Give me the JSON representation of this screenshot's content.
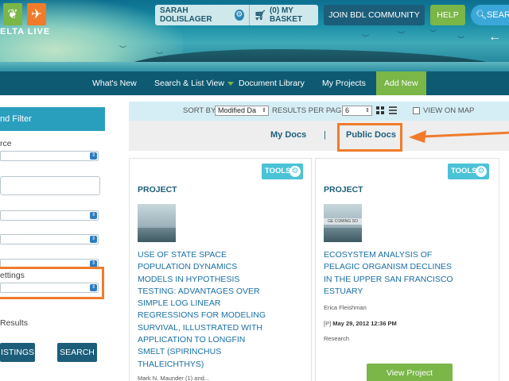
{
  "header": {
    "logo_text": "ELTA LIVE",
    "user_name": "SARAH DOLISLAGER",
    "basket_label": "(0) MY BASKET",
    "join_label": "JOIN BDL COMMUNITY",
    "help_label": "HELP",
    "search_label": "SEAR",
    "back_arrow": "←"
  },
  "nav": {
    "items": [
      {
        "label": "What's New"
      },
      {
        "label": "Search & List View"
      },
      {
        "label": "Document Library"
      },
      {
        "label": "My Projects"
      },
      {
        "label": "Add New"
      }
    ]
  },
  "left_panel": {
    "title": "nd Filter",
    "source_label": "rce",
    "settings_label": "ettings",
    "results_label": "Results",
    "listings_button": "ISTINGS",
    "search_button": "SEARCH"
  },
  "sort_bar": {
    "sort_label": "SORT BY",
    "sort_value": "Modified Da",
    "results_label": "RESULTS PER PAGE",
    "results_value": "6",
    "view_on_map": "VIEW ON MAP"
  },
  "docs_tabs": {
    "my_docs": "My Docs",
    "separator": "|",
    "public_docs": "Public Docs"
  },
  "cards": [
    {
      "tools_label": "TOOLS",
      "type": "PROJECT",
      "title_lines": [
        "USE OF STATE SPACE",
        "POPULATION DYNAMICS",
        "MODELS IN HYPOTHESIS",
        "TESTING: ADVANTAGES OVER",
        "SIMPLE LOG LINEAR",
        "REGRESSIONS FOR MODELING",
        "SURVIVAL, ILLUSTRATED WITH",
        "APPLICATION TO LONGFIN",
        "SMELT (SPIRINCHUS",
        "THALEICHTHYS)"
      ],
      "author": "Mark N. Maunder (1) and..."
    },
    {
      "tools_label": "TOOLS",
      "type": "PROJECT",
      "thumb_text": "GE COMING SO",
      "title_lines": [
        "ECOSYSTEM ANALYSIS OF",
        "PELAGIC ORGANISM DECLINES",
        "IN THE UPPER SAN FRANCISCO",
        "ESTUARY"
      ],
      "author": "Erica Fleishman",
      "status": "[P]",
      "date": "May 29, 2012 12:36 PM",
      "category": "Research",
      "view_button": "View Project"
    }
  ],
  "colors": {
    "nav_bg": "#0f5a73",
    "accent_green": "#7ab648",
    "accent_orange": "#f07b2a",
    "link_blue": "#1a6fa3",
    "tools_teal": "#4bc3d6"
  }
}
